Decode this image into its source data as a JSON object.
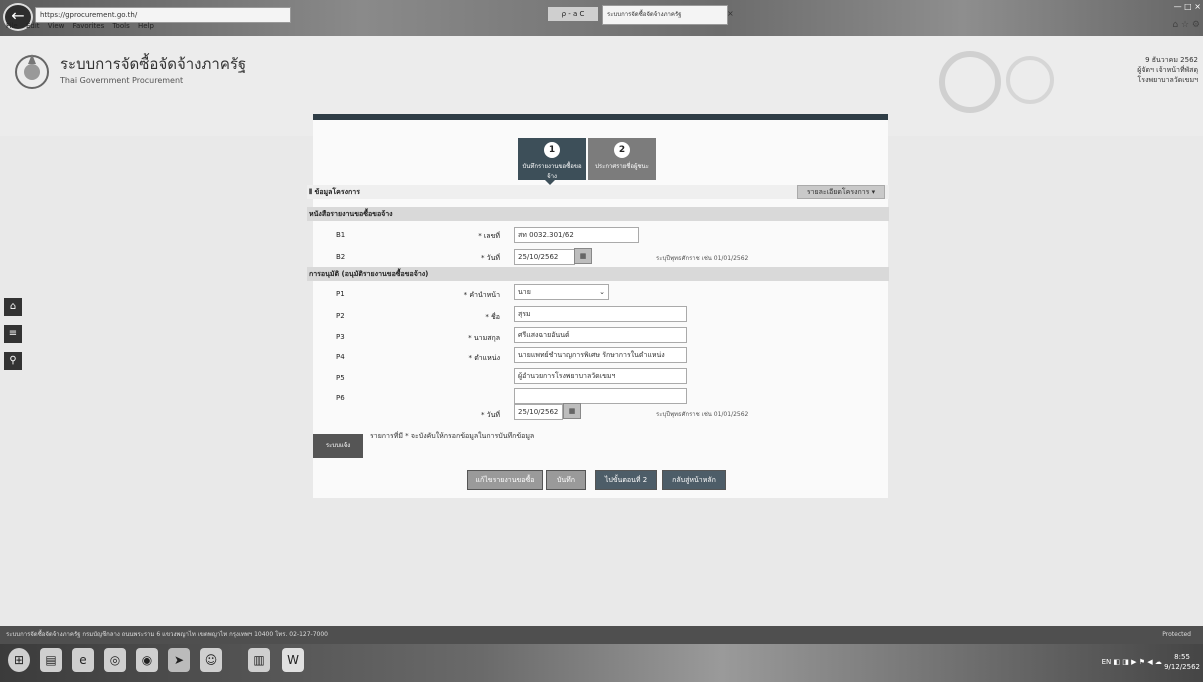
{
  "browser": {
    "address": "https://gprocurement.go.th/",
    "address_controls": "ρ - a C",
    "tab_title": "ระบบการจัดซื้อจัดจ้างภาครัฐ",
    "tab_close": "×",
    "window_controls": "— □ ×",
    "tool_icons": "⌂ ☆ ⚙",
    "menu": [
      "File",
      "Edit",
      "View",
      "Favorites",
      "Tools",
      "Help"
    ]
  },
  "header": {
    "title": "ระบบการจัดซื้อจัดจ้างภาครัฐ",
    "subtitle": "Thai Government Procurement",
    "date": "9 ธันวาคม 2562",
    "user_line1": "ผู้จัดฯ เจ้าหน้าที่พัสดุ",
    "user_line2": "โรงพยาบาลวัดเขมฯ"
  },
  "steps": [
    {
      "num": "1",
      "label": "บันทึกรายงานขอซื้อขอจ้าง"
    },
    {
      "num": "2",
      "label": "ประกาศรายชื่อผู้ชนะ"
    }
  ],
  "project": {
    "title": "ข้อมูลโครงการ",
    "dropdown": "รายละเอียดโครงการ ▾"
  },
  "section1": {
    "title": "หนังสือรายงานขอซื้อขอจ้าง",
    "rows": [
      {
        "code": "B1",
        "cap": "* เลขที่",
        "value": "สท 0032.301/62"
      },
      {
        "code": "B2",
        "cap": "* วันที่",
        "value": "25/10/2562",
        "hint": "ระบุปีพุทธศักราช เช่น 01/01/2562"
      }
    ]
  },
  "section2": {
    "title": "การอนุมัติ (อนุมัติรายงานขอซื้อขอจ้าง)",
    "rows": [
      {
        "code": "P1",
        "cap": "* คำนำหน้า",
        "value": "นาย"
      },
      {
        "code": "P2",
        "cap": "* ชื่อ",
        "value": "สุรม"
      },
      {
        "code": "P3",
        "cap": "* นามสกุล",
        "value": "ศรีแสงฉายอันนต์"
      },
      {
        "code": "P4",
        "cap": "* ตำแหน่ง",
        "value": "นายแพทย์ชำนาญการพิเศษ รักษาการในตำแหน่ง"
      },
      {
        "code": "P5",
        "cap": "",
        "value": "ผู้อำนวยการโรงพยาบาลวัดเขมฯ"
      },
      {
        "code": "P6",
        "cap": "",
        "value": ""
      },
      {
        "code": "",
        "cap": "* วันที่",
        "value": "25/10/2562",
        "hint": "ระบุปีพุทธศักราช เช่น 01/01/2562"
      }
    ]
  },
  "left_tag": "ระบบแจ้ง",
  "note": "รายการที่มี * จะบังคับให้กรอกข้อมูลในการบันทึกข้อมูล",
  "buttons": {
    "b1": "แก้ไขรายงานขอซื้อ",
    "b2": "บันทึก",
    "b3": "ไปขั้นตอนที่ 2",
    "b4": "กลับสู่หน้าหลัก"
  },
  "side_icons": [
    "home-icon",
    "menu-icon",
    "search-icon"
  ],
  "statusbar": "ระบบการจัดซื้อจัดจ้างภาครัฐ กรมบัญชีกลาง ถนนพระราม 6 แขวงพญาไท เขตพญาไท กรุงเทพฯ 10400 โทร. 02-127-7000",
  "statusbar_right": "Protected",
  "tray": {
    "time": "8:55",
    "date": "9/12/2562",
    "lang": "EN"
  },
  "colors": {
    "step_active": "#3d4f59",
    "step_inactive": "#7c7c7c",
    "btn_gray": "#9a9a9a",
    "btn_dark": "#4d5d68"
  }
}
